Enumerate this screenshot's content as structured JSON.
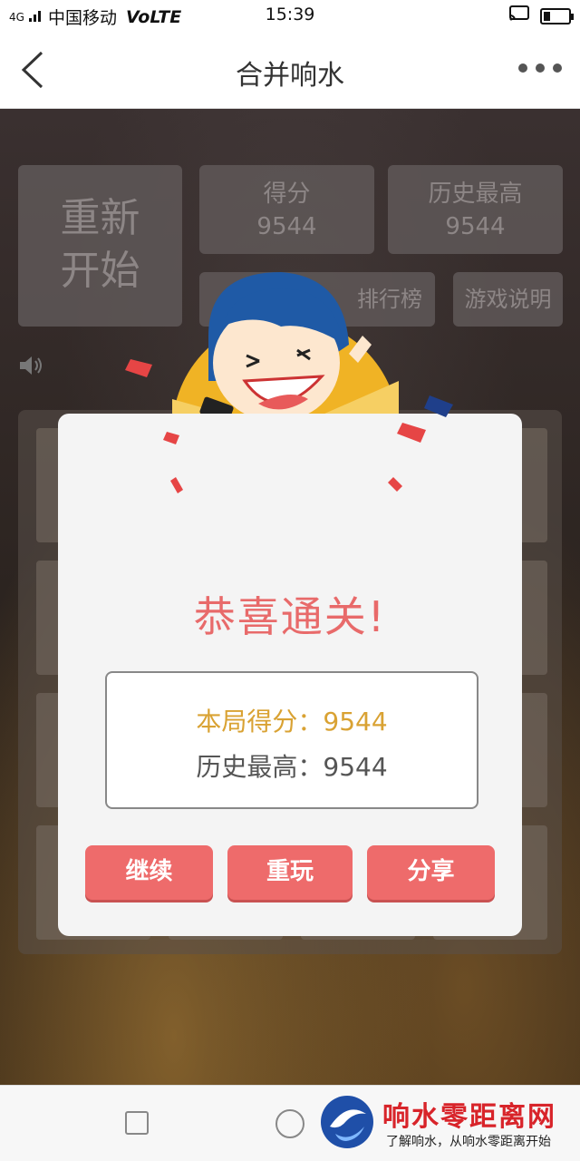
{
  "status_bar": {
    "signal": "4G",
    "carrier": "中国移动",
    "volte": "VoLTE",
    "time": "15:39",
    "battery_level": 0.25
  },
  "nav": {
    "title": "合并响水",
    "back_icon": "chevron-left-icon",
    "more_icon": "more-dots-icon"
  },
  "game": {
    "restart_line1": "重新",
    "restart_line2": "开始",
    "score_label": "得分",
    "score_value": "9544",
    "best_label": "历史最高",
    "best_value": "9544",
    "leaderboard_label": "排行榜",
    "rules_label": "游戏说明",
    "sound_icon": "speaker-icon"
  },
  "modal": {
    "title": "恭喜通关!",
    "round_score_label": "本局得分：",
    "round_score_value": "9544",
    "history_best_label": "历史最高：",
    "history_best_value": "9544",
    "buttons": {
      "continue": "继续",
      "replay": "重玩",
      "share": "分享"
    },
    "accent_color": "#ee6b6b",
    "score_color": "#d9a233"
  },
  "watermark": {
    "title": "响水零距离网",
    "subtitle": "了解响水，从响水零距离开始"
  }
}
